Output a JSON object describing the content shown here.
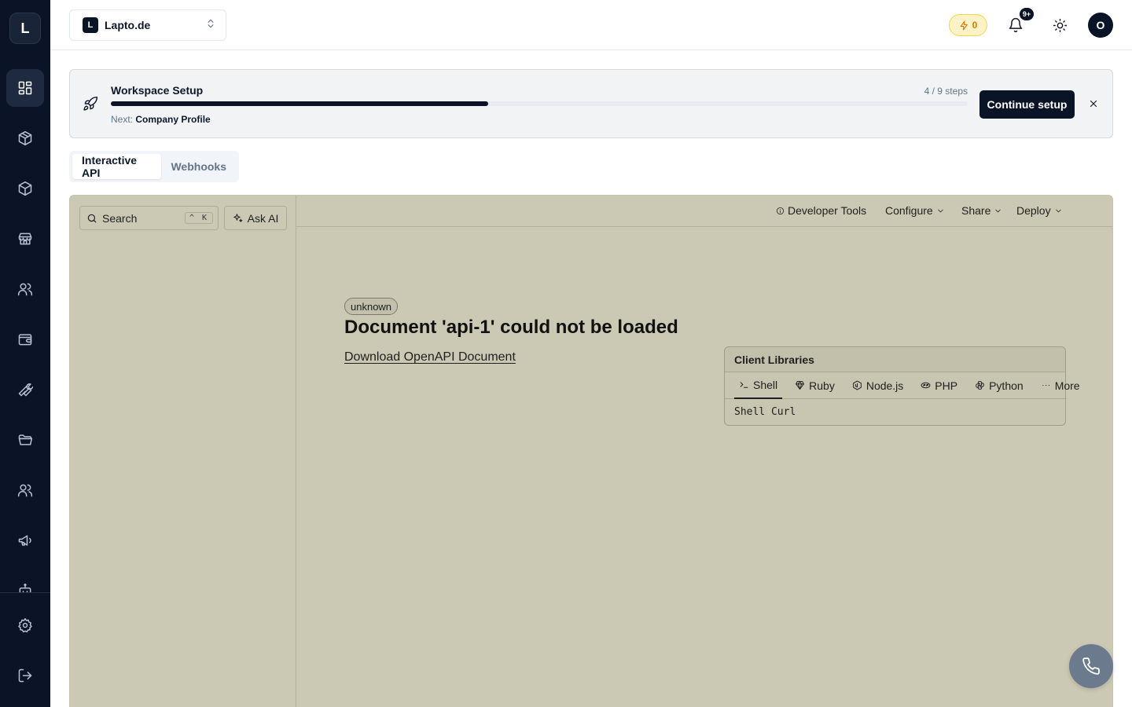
{
  "sidebar": {
    "logo_letter": "L",
    "items": [
      {
        "icon": "dashboard-icon"
      },
      {
        "icon": "package-icon"
      },
      {
        "icon": "box-icon"
      },
      {
        "icon": "store-icon"
      },
      {
        "icon": "users-icon"
      },
      {
        "icon": "wallet-icon"
      },
      {
        "icon": "wrench-icon"
      },
      {
        "icon": "folder-icon"
      },
      {
        "icon": "team-icon"
      },
      {
        "icon": "megaphone-icon"
      },
      {
        "icon": "bot-icon"
      }
    ],
    "bottom_items": [
      {
        "icon": "settings-icon"
      },
      {
        "icon": "logout-icon"
      }
    ]
  },
  "header": {
    "workspace_badge": "L",
    "workspace_name": "Lapto.de",
    "credits": "0",
    "notification_badge": "9+",
    "avatar_letter": "O"
  },
  "setup": {
    "title": "Workspace Setup",
    "steps_label": "4 / 9 steps",
    "progress_fraction": 0.44,
    "next_prefix": "Next:",
    "next_step": "Company Profile",
    "continue_label": "Continue setup"
  },
  "tabs": [
    {
      "label": "Interactive API",
      "active": true
    },
    {
      "label": "Webhooks",
      "active": false
    }
  ],
  "api_panel": {
    "search_placeholder": "Search",
    "search_shortcut": "^ K",
    "ask_ai_label": "Ask AI",
    "toolbar": {
      "developer_tools": "Developer Tools",
      "configure": "Configure",
      "share": "Share",
      "deploy": "Deploy"
    },
    "status": "unknown",
    "error_title": "Document 'api-1' could not be loaded",
    "download_link": "Download OpenAPI Document",
    "client_libraries": {
      "title": "Client Libraries",
      "tabs": [
        "Shell",
        "Ruby",
        "Node.js",
        "PHP",
        "Python",
        "More"
      ],
      "active_tab": "Shell",
      "code": "Shell Curl"
    }
  },
  "colors": {
    "sidebar_bg": "#0b1427",
    "panel_bg": "#cbc9b3",
    "accent": "#0b1427",
    "credit_accent": "#d97706"
  }
}
